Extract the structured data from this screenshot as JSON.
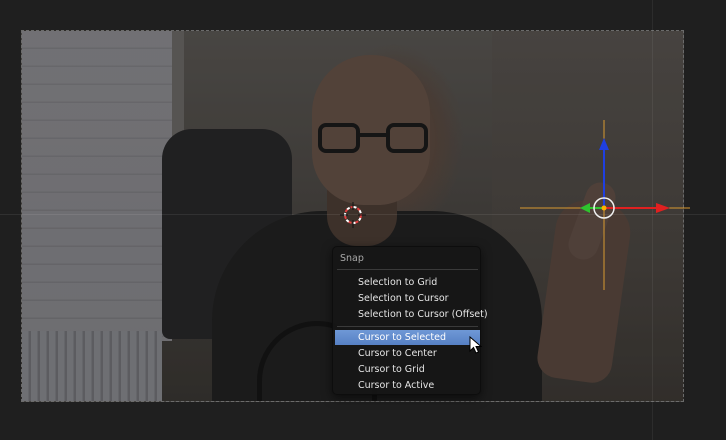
{
  "viewport": {
    "description_icon": "camera-background-image"
  },
  "menu": {
    "title": "Snap",
    "items": [
      {
        "label": "Selection to Grid",
        "active": false
      },
      {
        "label": "Selection to Cursor",
        "active": false
      },
      {
        "label": "Selection to Cursor (Offset)",
        "active": false
      },
      {
        "label": "Cursor to Selected",
        "active": true
      },
      {
        "label": "Cursor to Center",
        "active": false
      },
      {
        "label": "Cursor to Grid",
        "active": false
      },
      {
        "label": "Cursor to Active",
        "active": false
      }
    ]
  },
  "colors": {
    "highlight": "#5680c4",
    "menu_bg": "#161616",
    "axis_x": "#e02020",
    "axis_y": "#2ec42e",
    "axis_z": "#1f3fe0",
    "origin_line": "#d89a30"
  },
  "icons": {
    "cursor": "3d-cursor-icon",
    "gizmo": "transform-gizmo-icon",
    "pointer": "mouse-pointer-icon"
  }
}
